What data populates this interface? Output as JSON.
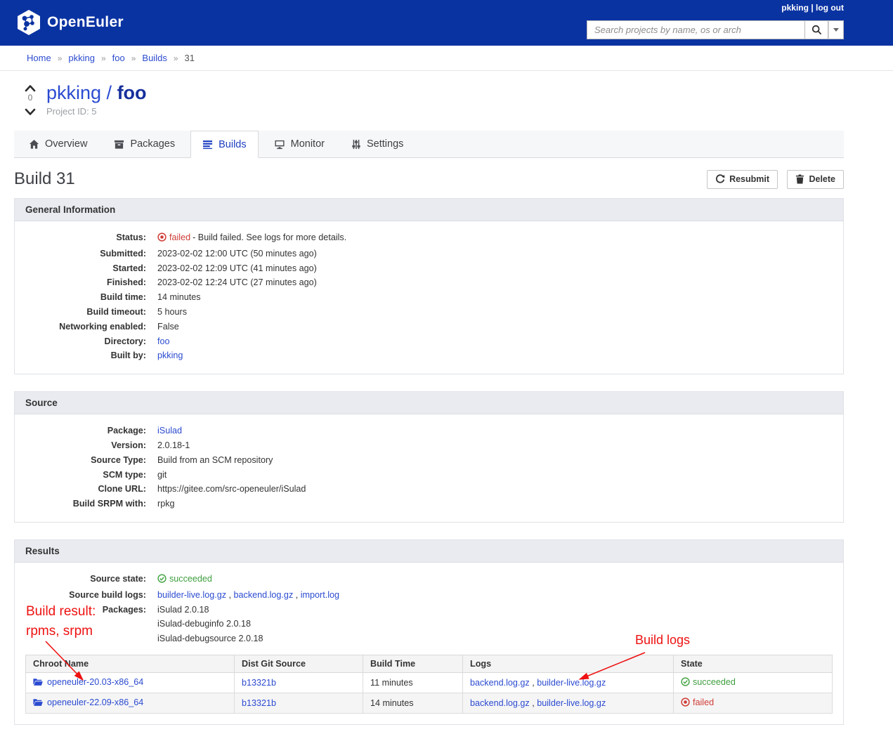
{
  "colors": {
    "header_blue": "#0a33a2",
    "link_blue": "#2b4bd0",
    "success_green": "#3f9e3f",
    "danger_red": "#cf3c36",
    "annotation_red": "#ee1111"
  },
  "header": {
    "brand": "OpenEuler",
    "user": "pkking",
    "pipe": "|",
    "logout": "log out",
    "search_placeholder": "Search projects by name, os or arch"
  },
  "breadcrumb": {
    "items": [
      "Home",
      "pkking",
      "foo",
      "Builds"
    ],
    "current": "31",
    "separator": "»"
  },
  "project": {
    "votes": "0",
    "owner": "pkking",
    "slash": " / ",
    "name": "foo",
    "meta": "Project ID: 5"
  },
  "tabs": [
    {
      "label": "Overview"
    },
    {
      "label": "Packages"
    },
    {
      "label": "Builds"
    },
    {
      "label": "Monitor"
    },
    {
      "label": "Settings"
    }
  ],
  "page": {
    "title": "Build 31",
    "resubmit": "Resubmit",
    "delete": "Delete"
  },
  "general_information": {
    "title": "General Information",
    "status_label": "Status:",
    "status_value": "failed",
    "status_message": "- Build failed. See logs for more details.",
    "rows": [
      {
        "label": "Submitted:",
        "value": "2023-02-02 12:00 UTC (50 minutes ago)"
      },
      {
        "label": "Started:",
        "value": "2023-02-02 12:09 UTC (41 minutes ago)"
      },
      {
        "label": "Finished:",
        "value": "2023-02-02 12:24 UTC (27 minutes ago)"
      },
      {
        "label": "Build time:",
        "value": "14 minutes"
      },
      {
        "label": "Build timeout:",
        "value": "5 hours"
      },
      {
        "label": "Networking enabled:",
        "value": "False"
      },
      {
        "label": "Directory:",
        "value": "foo"
      },
      {
        "label": "Built by:",
        "value": "pkking"
      }
    ]
  },
  "source": {
    "title": "Source",
    "rows": [
      {
        "label": "Package:",
        "value": "iSulad"
      },
      {
        "label": "Version:",
        "value": "2.0.18-1"
      },
      {
        "label": "Source Type:",
        "value": "Build from an SCM repository"
      },
      {
        "label": "SCM type:",
        "value": "git"
      },
      {
        "label": "Clone URL:",
        "value": "https://gitee.com/src-openeuler/iSulad"
      },
      {
        "label": "Build SRPM with:",
        "value": "rpkg"
      }
    ]
  },
  "results": {
    "title": "Results",
    "source_state_label": "Source state:",
    "source_state": "succeeded",
    "source_logs_label": "Source build logs:",
    "source_logs": [
      "builder-live.log.gz",
      "backend.log.gz",
      "import.log"
    ],
    "comma": " , ",
    "packages_label": "Packages:",
    "packages": [
      "iSulad 2.0.18",
      "iSulad-debuginfo 2.0.18",
      "iSulad-debugsource 2.0.18"
    ]
  },
  "table": {
    "headers": [
      "Chroot Name",
      "Dist Git Source",
      "Build Time",
      "Logs",
      "State"
    ],
    "rows": [
      {
        "chroot": "openeuler-20.03-x86_64",
        "dist": "b13321b",
        "time": "11 minutes",
        "logs": [
          "backend.log.gz",
          "builder-live.log.gz"
        ],
        "state": "succeeded"
      },
      {
        "chroot": "openeuler-22.09-x86_64",
        "dist": "b13321b",
        "time": "14 minutes",
        "logs": [
          "backend.log.gz",
          "builder-live.log.gz"
        ],
        "state": "failed"
      }
    ]
  },
  "annotations": {
    "line1": "Build result:",
    "line2": "rpms, srpm",
    "logs": "Build logs"
  }
}
